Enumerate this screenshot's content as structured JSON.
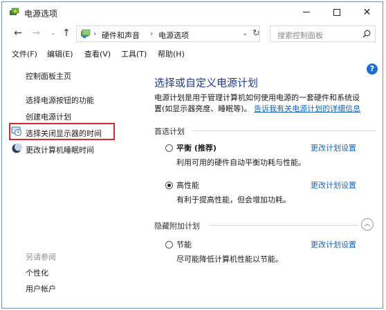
{
  "window": {
    "title": "电源选项",
    "controls": {
      "minimize": "",
      "maximize": "",
      "close": "✕"
    }
  },
  "nav": {
    "back": "←",
    "forward": "→",
    "recent": "⌄",
    "up": "↑",
    "breadcrumb": [
      "硬件和声音",
      "电源选项"
    ],
    "separator": "›",
    "dropdown": "⌄",
    "refresh": "↻",
    "search_placeholder": "搜索控制面板"
  },
  "menu": [
    "文件(F)",
    "编辑(E)",
    "查看(V)",
    "工具(T)",
    "帮助(H)"
  ],
  "sidebar": {
    "home": "控制面板主页",
    "links": [
      "选择电源按钮的功能",
      "创建电源计划",
      "选择关闭显示器的时间",
      "更改计算机睡眠时间"
    ],
    "see_also_header": "另请参阅",
    "see_also": [
      "个性化",
      "用户帐户"
    ]
  },
  "main": {
    "help": "?",
    "title": "选择或自定义电源计划",
    "description_line1": "电源计划是用于管理计算机如何使用电源的一套硬件和系统设",
    "description_line2": "置(如显示器亮度、睡眠等)。",
    "description_link": "告诉我有关电源计划的详细信息",
    "preferred_header": "首选计划",
    "hidden_header": "隐藏附加计划",
    "collapse": "︿",
    "plans": [
      {
        "name": "平衡 (推荐)",
        "desc": "利用可用的硬件自动平衡功耗与性能。",
        "link": "更改计划设置",
        "selected": false
      },
      {
        "name": "高性能",
        "desc": "有利于提高性能，但会增加功耗。",
        "link": "更改计划设置",
        "selected": true
      },
      {
        "name": "节能",
        "desc": "尽可能降低计算机性能以节能。",
        "link": "更改计划设置",
        "selected": false
      }
    ]
  },
  "colors": {
    "title_blue": "#1f3a8c",
    "link_blue": "#1565c0",
    "highlight_red": "#d9242c"
  }
}
